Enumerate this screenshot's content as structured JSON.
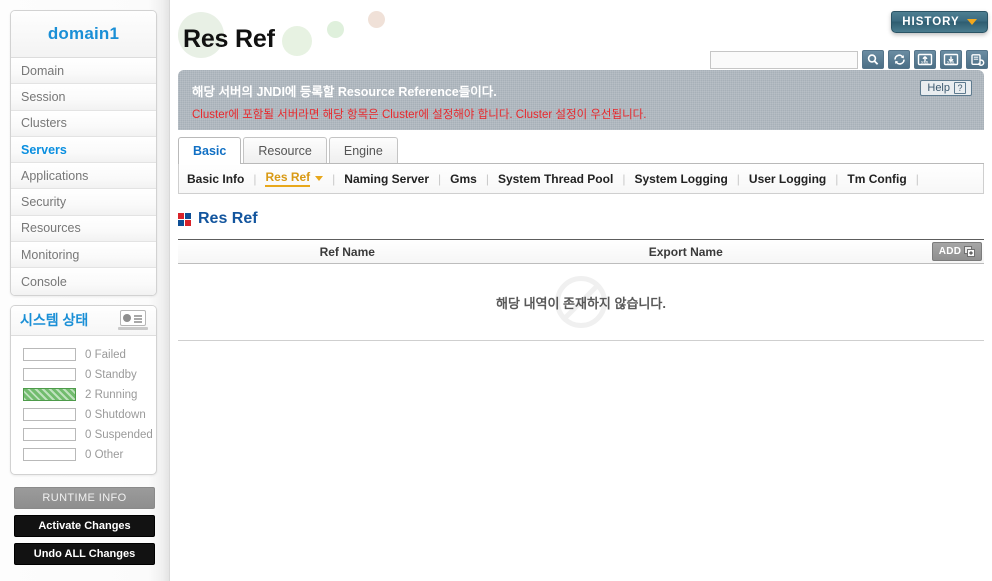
{
  "sidebar": {
    "domain_title": "domain1",
    "nav_items": [
      {
        "label": "Domain",
        "active": false
      },
      {
        "label": "Session",
        "active": false
      },
      {
        "label": "Clusters",
        "active": false
      },
      {
        "label": "Servers",
        "active": true
      },
      {
        "label": "Applications",
        "active": false
      },
      {
        "label": "Security",
        "active": false
      },
      {
        "label": "Resources",
        "active": false
      },
      {
        "label": "Monitoring",
        "active": false
      },
      {
        "label": "Console",
        "active": false
      }
    ],
    "system_status": {
      "title": "시스템 상태",
      "icon": "laptop-chart-icon",
      "rows": [
        {
          "count": "0",
          "label": "Failed",
          "filled": false
        },
        {
          "count": "0",
          "label": "Standby",
          "filled": false
        },
        {
          "count": "2",
          "label": "Running",
          "filled": true
        },
        {
          "count": "0",
          "label": "Shutdown",
          "filled": false
        },
        {
          "count": "0",
          "label": "Suspended",
          "filled": false
        },
        {
          "count": "0",
          "label": "Other",
          "filled": false
        }
      ],
      "fill_color": "#72bc6e"
    },
    "buttons": [
      {
        "label": "RUNTIME INFO",
        "style": "grey"
      },
      {
        "label": "Activate Changes",
        "style": "dark"
      },
      {
        "label": "Undo ALL Changes",
        "style": "dark"
      }
    ]
  },
  "header": {
    "page_title": "Res Ref",
    "history_button": {
      "label": "HISTORY",
      "caret_icon": "chevron-down-icon"
    },
    "search": {
      "value": "",
      "placeholder": ""
    },
    "toolbar_icons": [
      {
        "name": "search-icon"
      },
      {
        "name": "refresh-icon"
      },
      {
        "name": "xml-upload-icon"
      },
      {
        "name": "xml-download-icon"
      },
      {
        "name": "reload-config-icon"
      }
    ]
  },
  "notice": {
    "line1": "해당 서버의 JNDI에 등록할 Resource Reference들이다.",
    "line2": "Cluster에 포함될 서버라면 해당 항목은 Cluster에 설정해야 합니다. Cluster 설정이 우선됩니다.",
    "help_label": "Help",
    "help_icon": "question-mark-icon",
    "warn_color": "#e8282c"
  },
  "tabs": [
    {
      "label": "Basic",
      "active": true
    },
    {
      "label": "Resource",
      "active": false
    },
    {
      "label": "Engine",
      "active": false
    }
  ],
  "subnav": [
    {
      "label": "Basic Info",
      "active": false,
      "has_caret": false
    },
    {
      "label": "Res Ref",
      "active": true,
      "has_caret": true
    },
    {
      "label": "Naming Server",
      "active": false,
      "has_caret": false
    },
    {
      "label": "Gms",
      "active": false,
      "has_caret": false
    },
    {
      "label": "System Thread Pool",
      "active": false,
      "has_caret": false
    },
    {
      "label": "System Logging",
      "active": false,
      "has_caret": false
    },
    {
      "label": "User Logging",
      "active": false,
      "has_caret": false
    },
    {
      "label": "Tm Config",
      "active": false,
      "has_caret": false
    }
  ],
  "section": {
    "title": "Res Ref",
    "icon": "four-square-icon",
    "accent_color": "#13559e"
  },
  "table": {
    "columns": [
      "Ref Name",
      "Export Name"
    ],
    "add_button": {
      "label": "ADD",
      "icon": "add-plus-icon"
    },
    "rows": [],
    "empty_message": "해당 내역이 존재하지 않습니다.",
    "empty_watermark_icon": "no-entry-icon"
  }
}
